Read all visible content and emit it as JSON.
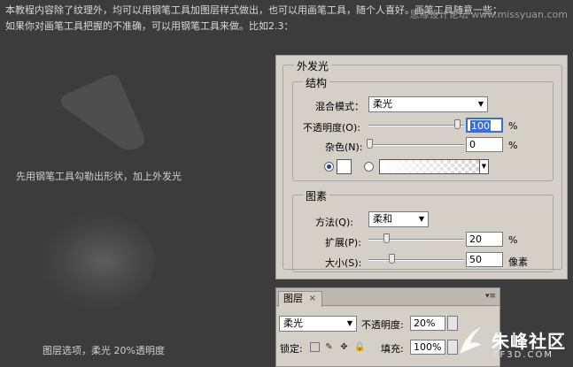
{
  "intro": {
    "line1": "本教程内容除了纹理外，均可以用钢笔工具加图层样式做出，也可以用画笔工具，随个人喜好。画笔工具随意一些；",
    "line2": "如果你对画笔工具把握的不准确，可以用钢笔工具来做。比如2.3："
  },
  "watermark_top": "思缘设计论坛 www.missyuan.com",
  "captions": {
    "shape": "先用钢笔工具勾勒出形状，加上外发光",
    "layer": "图层选项，柔光 20%透明度"
  },
  "outer_glow": {
    "title": "外发光",
    "structure": {
      "legend": "结构",
      "blend_mode_label": "混合模式：",
      "blend_mode_value": "柔光",
      "opacity_label": "不透明度(O):",
      "opacity_value": "100",
      "opacity_unit": "%",
      "noise_label": "杂色(N):",
      "noise_value": "0",
      "noise_unit": "%"
    },
    "elements": {
      "legend": "图素",
      "method_label": "方法(Q):",
      "method_value": "柔和",
      "spread_label": "扩展(P):",
      "spread_value": "20",
      "spread_unit": "%",
      "size_label": "大小(S):",
      "size_value": "50",
      "size_unit": "像素"
    }
  },
  "layers_panel": {
    "tab_label": "图层",
    "close_glyph": "×",
    "blend_mode": "柔光",
    "opacity_label": "不透明度:",
    "opacity_value": "20%",
    "lock_label": "锁定:",
    "fill_label": "填充:",
    "fill_value": "100%"
  },
  "brand": {
    "name": "朱峰社区",
    "url": "ZF3D.COM"
  }
}
